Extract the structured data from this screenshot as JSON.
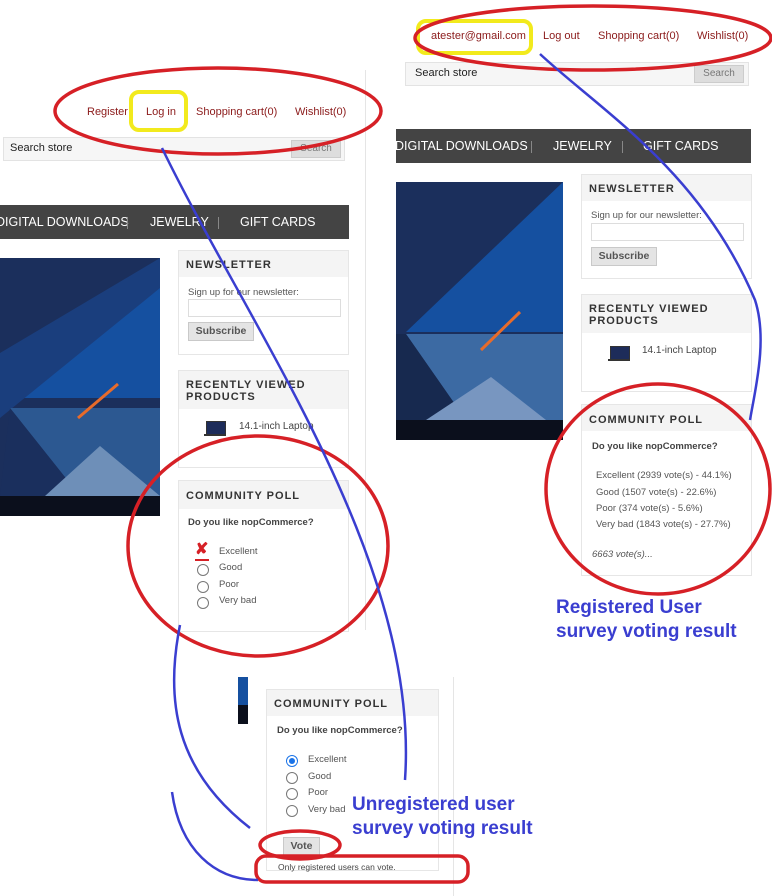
{
  "left_panel": {
    "header_links": [
      "Register",
      "Log in",
      "Shopping cart(0)",
      "Wishlist(0)"
    ],
    "search_placeholder": "Search store",
    "search_button": "Search",
    "menu": [
      "DIGITAL DOWNLOADS",
      "JEWELRY",
      "GIFT CARDS"
    ],
    "newsletter": {
      "title": "NEWSLETTER",
      "prompt": "Sign up for our newsletter:",
      "button": "Subscribe"
    },
    "recently_viewed": {
      "title": "RECENTLY VIEWED PRODUCTS",
      "title_line1": "RECENTLY VIEWED",
      "title_line2": "PRODUCTS",
      "product": "14.1-inch Laptop"
    },
    "poll": {
      "title": "COMMUNITY POLL",
      "question": "Do you like nopCommerce?",
      "options": [
        "Excellent",
        "Good",
        "Poor",
        "Very bad"
      ]
    }
  },
  "right_panel": {
    "header_links": [
      "atester@gmail.com",
      "Log out",
      "Shopping cart(0)",
      "Wishlist(0)"
    ],
    "search_placeholder": "Search store",
    "search_button": "Search",
    "menu": [
      "DIGITAL DOWNLOADS",
      "JEWELRY",
      "GIFT CARDS"
    ],
    "newsletter": {
      "title": "NEWSLETTER",
      "prompt": "Sign up for our newsletter:",
      "button": "Subscribe"
    },
    "recently_viewed": {
      "title_line1": "RECENTLY VIEWED",
      "title_line2": "PRODUCTS",
      "product": "14.1-inch Laptop"
    },
    "poll": {
      "title": "COMMUNITY POLL",
      "question": "Do you like nopCommerce?",
      "results": [
        "Excellent (2939 vote(s) - 44.1%)",
        "Good (1507 vote(s) - 22.6%)",
        "Poor (374 vote(s) - 5.6%)",
        "Very bad (1843 vote(s) - 27.7%)"
      ],
      "total": "6663 vote(s)..."
    }
  },
  "bottom_panel": {
    "poll": {
      "title": "COMMUNITY POLL",
      "question": "Do you like nopCommerce?",
      "options": [
        "Excellent",
        "Good",
        "Poor",
        "Very bad"
      ],
      "selected": "Excellent",
      "vote_button": "Vote",
      "message": "Only registered users can vote."
    }
  },
  "captions": {
    "registered_line1": "Registered User",
    "registered_line2": "survey voting result",
    "unregistered_line1": "Unregistered user",
    "unregistered_line2": "survey voting result"
  },
  "colors": {
    "annotation_red": "#d62026",
    "annotation_yellow": "#f2ea1d",
    "annotation_blue": "#3a3ed0",
    "link": "#8b1a1a",
    "menu_bg": "#444444"
  }
}
